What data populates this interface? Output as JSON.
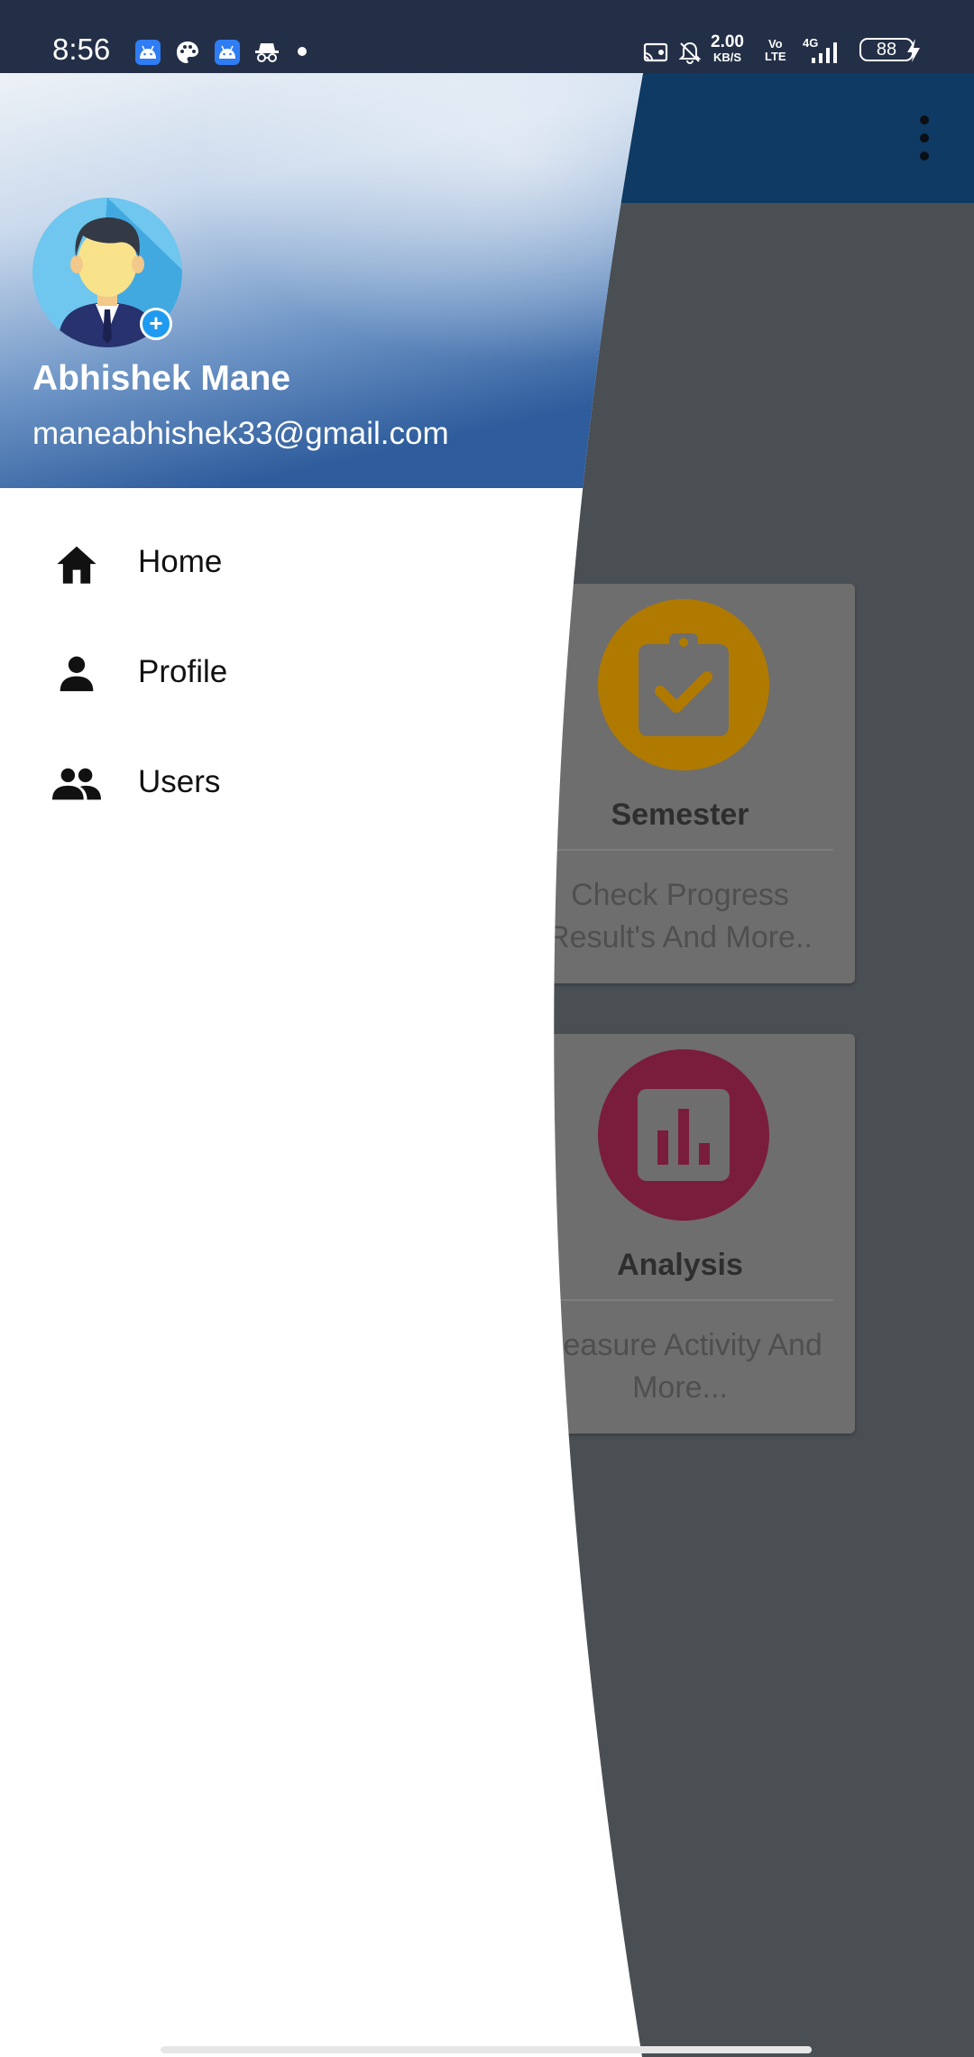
{
  "status_bar": {
    "time": "8:56",
    "net_speed_value": "2.00",
    "net_speed_unit": "KB/S",
    "volte_top": "Vo",
    "volte_bottom": "LTE",
    "network_type": "4G",
    "battery_level": "88",
    "notification_icons": [
      "android-icon",
      "palette-icon",
      "android-icon",
      "incognito-icon"
    ],
    "system_icons": [
      "cast-icon",
      "bell-off-icon",
      "signal-icon",
      "charging-icon"
    ]
  },
  "drawer": {
    "user_name": "Abhishek Mane",
    "user_email": "maneabhishek33@gmail.com",
    "avatar_badge": "+",
    "menu": [
      {
        "label": "Home",
        "icon": "home-icon"
      },
      {
        "label": "Profile",
        "icon": "person-icon"
      },
      {
        "label": "Users",
        "icon": "people-icon"
      }
    ]
  },
  "app": {
    "cards": [
      {
        "title": "Semester",
        "desc_line1": "Check Progress",
        "desc_line2": "Result's And More..",
        "icon": "clipboard-check-icon",
        "color": "#b07a00"
      },
      {
        "title": "Analysis",
        "desc_line1": "Measure Activity And",
        "desc_line2": "More...",
        "icon": "bar-chart-icon",
        "color": "#7a1d3d"
      }
    ]
  },
  "colors": {
    "status_bar": "#232f46",
    "app_bar": "#0e3a63",
    "scrim_background": "#4a4f54",
    "drawer_background": "#ffffff"
  }
}
